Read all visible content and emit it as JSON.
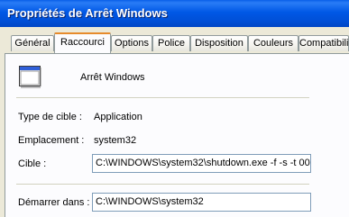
{
  "window": {
    "title": "Propriétés de Arrêt Windows"
  },
  "tabs": [
    {
      "label": "Général"
    },
    {
      "label": "Raccourci"
    },
    {
      "label": "Options"
    },
    {
      "label": "Police"
    },
    {
      "label": "Disposition"
    },
    {
      "label": "Couleurs"
    },
    {
      "label": "Compatibilit"
    }
  ],
  "active_tab": "Raccourci",
  "shortcut": {
    "name": "Arrêt Windows",
    "target_type_label": "Type de cible :",
    "target_type_value": "Application",
    "location_label": "Emplacement :",
    "location_value": "system32",
    "target_label": "Cible :",
    "target_value": "C:\\WINDOWS\\system32\\shutdown.exe -f -s -t 00",
    "start_in_label": "Démarrer dans :",
    "start_in_value": "C:\\WINDOWS\\system32"
  },
  "colors": {
    "title_bar": "#0054e3",
    "active_tab_accent": "#e68b2c",
    "field_border": "#7f9db9"
  },
  "icons": {
    "app": "application-window-icon"
  }
}
